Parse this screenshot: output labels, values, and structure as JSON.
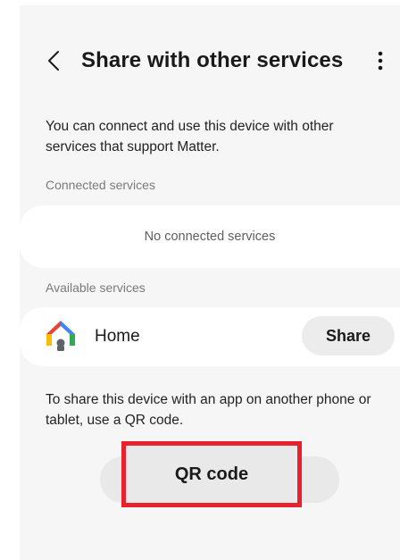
{
  "header": {
    "title": "Share with other services",
    "back_icon": "chevron-left-icon",
    "more_icon": "more-vertical-icon"
  },
  "intro_text": "You can connect and use this device with other services that support Matter.",
  "connected": {
    "label": "Connected services",
    "empty_text": "No connected services"
  },
  "available": {
    "label": "Available services",
    "services": [
      {
        "name": "Home",
        "icon": "google-home-icon",
        "action_label": "Share"
      }
    ]
  },
  "qr": {
    "hint": "To share this device with an app on another phone or tablet, use a QR code.",
    "button_label": "QR code",
    "highlight_color": "#e8222c"
  }
}
